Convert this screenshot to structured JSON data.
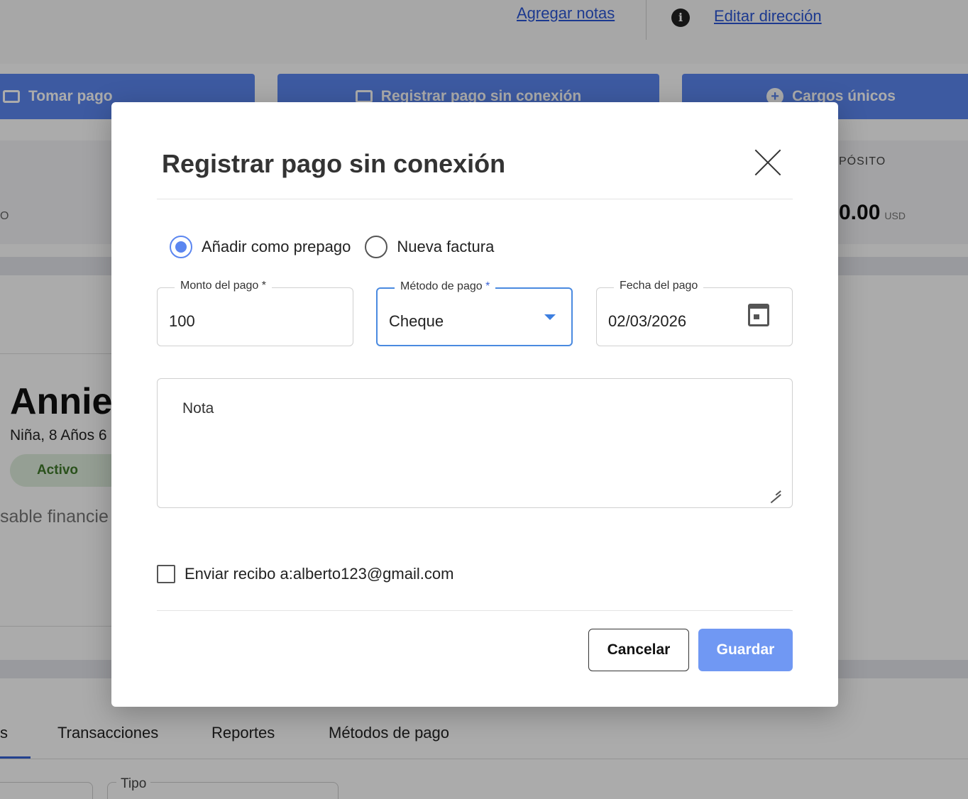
{
  "background": {
    "links": {
      "add_notes": "Agregar notas",
      "edit_address": "Editar dirección"
    },
    "actions": {
      "take_payment": "Tomar pago",
      "register_offline": "Registrar pago sin conexión",
      "one_time_charges": "Cargos únicos"
    },
    "deposit": {
      "label": "PÓSITO",
      "value": "0.00",
      "unit": "USD"
    },
    "left_fragment": "O",
    "student": {
      "name": "Annie",
      "subtitle": "Niña, 8 Años 6",
      "status": "Activo",
      "responsible_label": "sable financie"
    },
    "tabs": [
      "s",
      "Transacciones",
      "Reportes",
      "Métodos de pago"
    ],
    "filter_label": "Tipo"
  },
  "modal": {
    "title": "Registrar pago sin conexión",
    "radio_options": [
      {
        "label": "Añadir como prepago",
        "checked": true
      },
      {
        "label": "Nueva factura",
        "checked": false
      }
    ],
    "fields": {
      "amount": {
        "label": "Monto del pago",
        "required_mark": "*",
        "value": "100"
      },
      "method": {
        "label": "Método de pago",
        "required_mark": "*",
        "value": "Cheque"
      },
      "date": {
        "label": "Fecha del pago",
        "value": "02/03/2026"
      }
    },
    "note_placeholder": "Nota",
    "send_receipt_label": "Enviar recibo a:alberto123@gmail.com",
    "buttons": {
      "cancel": "Cancelar",
      "save": "Guardar"
    },
    "icons": {
      "close": "close-icon",
      "calendar": "calendar-icon",
      "dropdown": "chevron-down-icon"
    },
    "accent_color": "#5b86f0"
  }
}
